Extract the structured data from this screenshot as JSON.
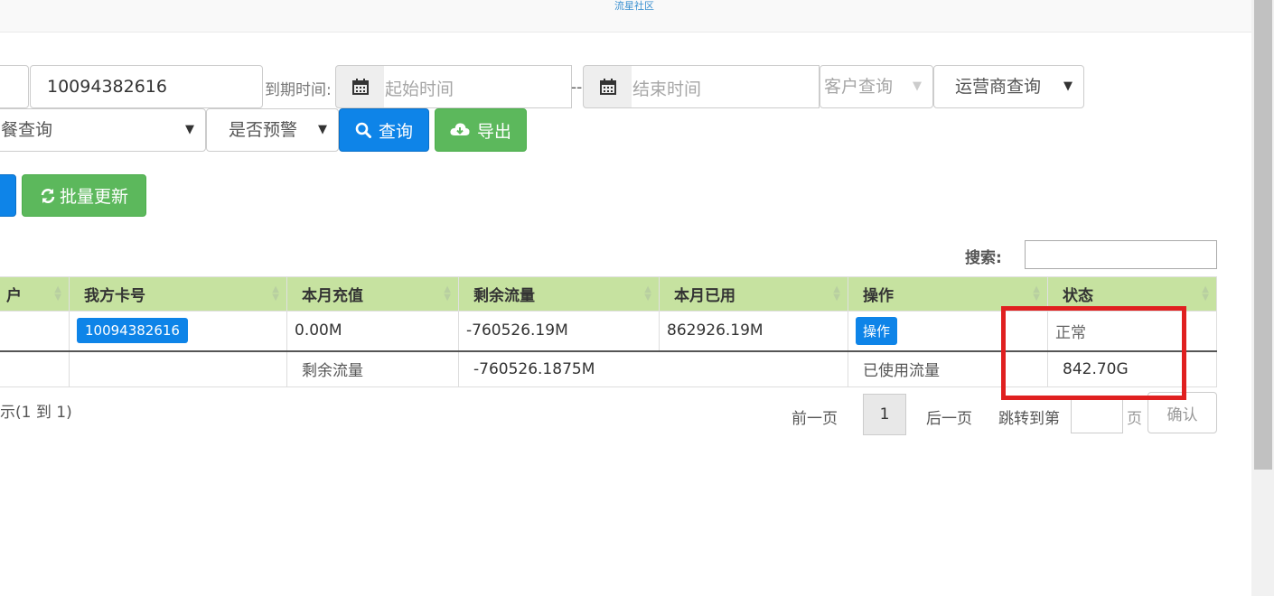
{
  "header": {
    "watermark": "流星社区"
  },
  "filters": {
    "card_number": "10094382616",
    "expire_label": "到期时间:",
    "start_placeholder": "起始时间",
    "dash": "--",
    "end_placeholder": "结束时间",
    "customer_select": "客户查询",
    "carrier_select": "运营商查询",
    "package_select": "餐查询",
    "warning_select": "是否预警",
    "query_button": "查询",
    "export_button": "导出",
    "batch_update_button": "批量更新"
  },
  "search": {
    "label": "搜索:"
  },
  "table": {
    "columns": [
      "户",
      "我方卡号",
      "本月充值",
      "剩余流量",
      "本月已用",
      "操作",
      "状态"
    ],
    "row": {
      "card_number": "10094382616",
      "recharge": "0.00M",
      "remaining": "-760526.19M",
      "used": "862926.19M",
      "operation": "操作",
      "status": "正常"
    },
    "summary": {
      "remaining_label": "剩余流量",
      "remaining_value": "-760526.1875M",
      "used_label": "已使用流量",
      "used_value": "842.70G"
    }
  },
  "pagination": {
    "info": "示(1 到 1)",
    "prev": "前一页",
    "current_page": "1",
    "next": "后一页",
    "jump_label": "跳转到第",
    "page_unit": "页",
    "confirm": "确认"
  },
  "annotation_color": "#e02020"
}
